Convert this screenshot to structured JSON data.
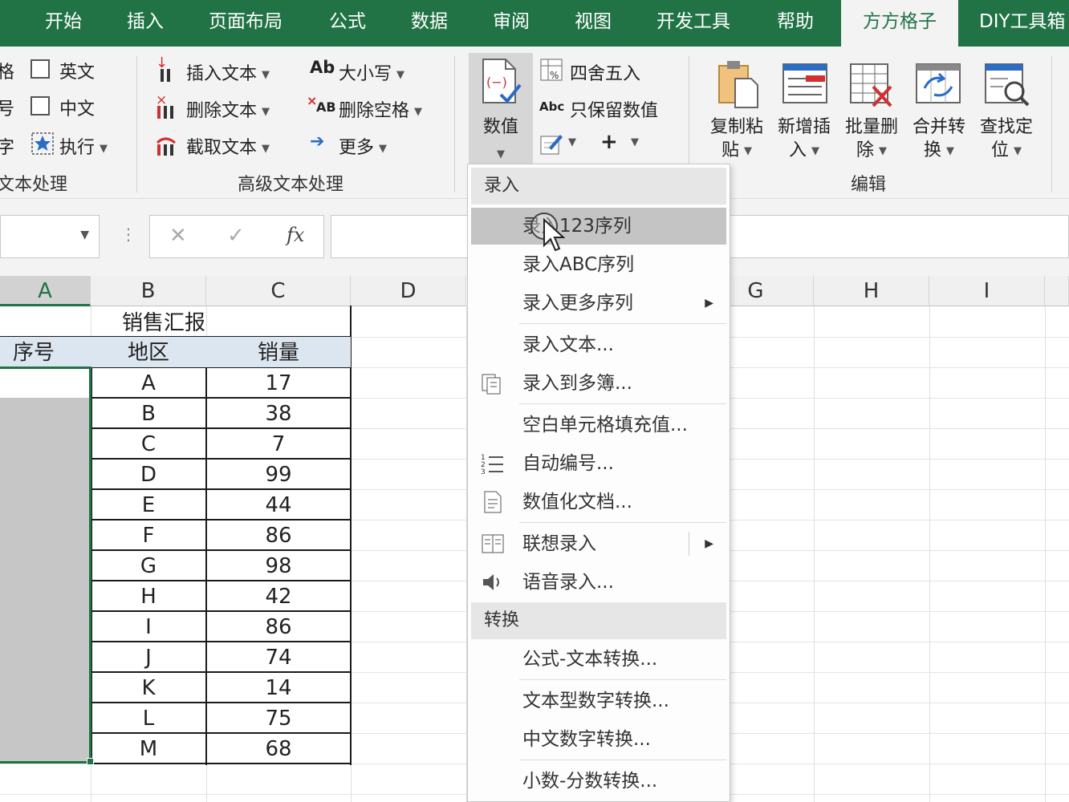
{
  "tabs": [
    {
      "label": "开始"
    },
    {
      "label": "插入"
    },
    {
      "label": "页面布局"
    },
    {
      "label": "公式"
    },
    {
      "label": "数据"
    },
    {
      "label": "审阅"
    },
    {
      "label": "视图"
    },
    {
      "label": "开发工具"
    },
    {
      "label": "帮助"
    },
    {
      "label": "方方格子"
    },
    {
      "label": "DIY工具箱"
    }
  ],
  "ribbon": {
    "left_group": {
      "partial_labels": [
        "格",
        "号",
        "字"
      ],
      "english_label": "英文",
      "chinese_label": "中文",
      "execute_label": "执行",
      "group_label": "文本处理"
    },
    "advanced_group": {
      "insert_text": "插入文本",
      "delete_text": "删除文本",
      "extract_text": "截取文本",
      "case": "大小写",
      "case_icon_text": "Ab",
      "remove_spaces": "删除空格",
      "remove_spaces_icon_text": "AB",
      "more": "更多",
      "group_label": "高级文本处理"
    },
    "numeric_group": {
      "numeric_button": "数值",
      "round": "四舍五入",
      "keep_values": "只保留数值",
      "keep_values_icon_text": "Abc",
      "plus": "+"
    },
    "edit_group": {
      "buttons": [
        {
          "line1": "复制粘",
          "line2": "贴"
        },
        {
          "line1": "新增插",
          "line2": "入"
        },
        {
          "line1": "批量删",
          "line2": "除"
        },
        {
          "line1": "合并转",
          "line2": "换"
        },
        {
          "line1": "查找定",
          "line2": "位"
        }
      ],
      "group_label": "编辑"
    }
  },
  "formula_bar": {
    "cancel_glyph": "✕",
    "confirm_glyph": "✓",
    "fx_label": "fx",
    "name_box_value": "",
    "formula_value": ""
  },
  "sheet": {
    "columns": [
      "A",
      "B",
      "C",
      "D",
      "G",
      "H",
      "I"
    ],
    "title": "销售汇报",
    "headers": {
      "seq": "序号",
      "region": "地区",
      "sales": "销量"
    },
    "rows": [
      {
        "region": "A",
        "sales": "17"
      },
      {
        "region": "B",
        "sales": "38"
      },
      {
        "region": "C",
        "sales": "7"
      },
      {
        "region": "D",
        "sales": "99"
      },
      {
        "region": "E",
        "sales": "44"
      },
      {
        "region": "F",
        "sales": "86"
      },
      {
        "region": "G",
        "sales": "98"
      },
      {
        "region": "H",
        "sales": "42"
      },
      {
        "region": "I",
        "sales": "86"
      },
      {
        "region": "J",
        "sales": "74"
      },
      {
        "region": "K",
        "sales": "14"
      },
      {
        "region": "L",
        "sales": "75"
      },
      {
        "region": "M",
        "sales": "68"
      }
    ]
  },
  "menu": {
    "section_input": "录入",
    "input_items": [
      "录入123序列",
      "录入ABC序列",
      "录入更多序列",
      "录入文本...",
      "录入到多簿...",
      "空白单元格填充值...",
      "自动编号...",
      "数值化文档...",
      "联想录入",
      "语音录入..."
    ],
    "section_convert": "转换",
    "convert_items": [
      "公式-文本转换...",
      "文本型数字转换...",
      "中文数字转换...",
      "小数-分数转换..."
    ]
  },
  "colors": {
    "tab_green": "#217346",
    "ribbon_bg": "#f3f3f3",
    "selection_fill": "#c6c6c6",
    "header_fill": "#dce6f1",
    "menu_hover": "#c4c4c4"
  }
}
